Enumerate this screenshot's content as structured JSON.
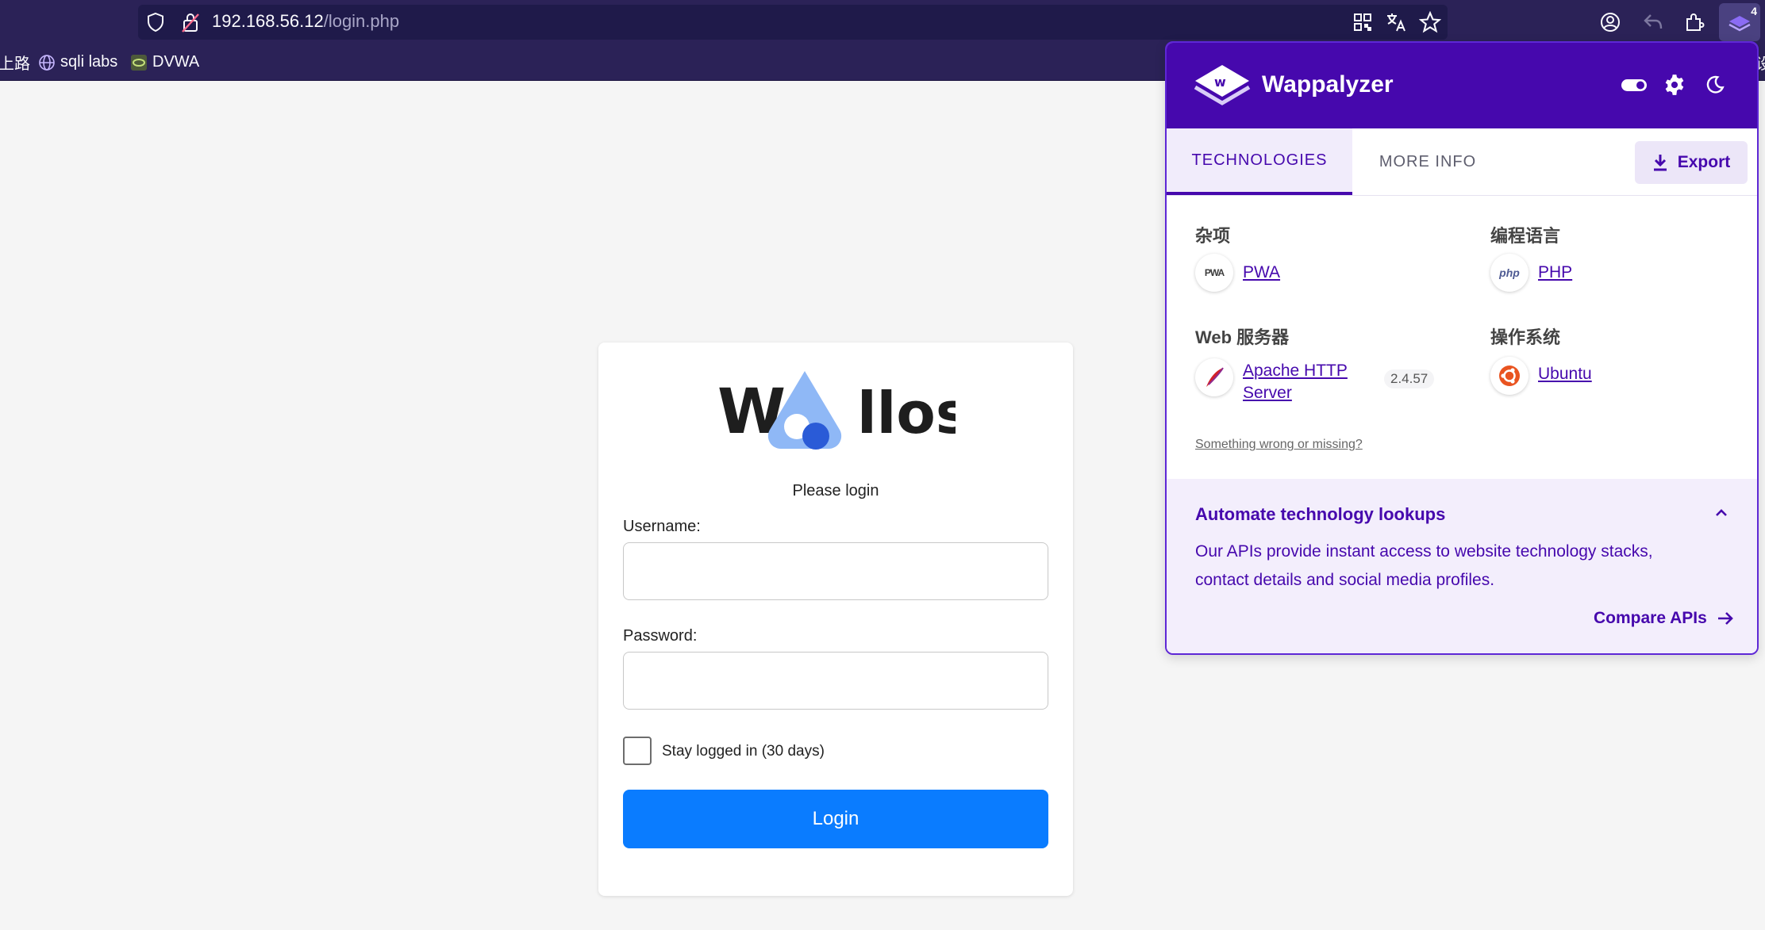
{
  "browser": {
    "url_host": "192.168.56.12",
    "url_path": "/login.php",
    "extension_badge": "4",
    "bookmarks": [
      {
        "label": "上路",
        "icon": "none"
      },
      {
        "label": "sqli labs",
        "icon": "globe-icon"
      },
      {
        "label": "DVWA",
        "icon": "dvwa-favicon"
      }
    ],
    "overflow_text": "设"
  },
  "login": {
    "logo_text_w": "W",
    "logo_text_rest": "llos",
    "heading": "Please login",
    "username_label": "Username:",
    "username_value": "",
    "password_label": "Password:",
    "password_value": "",
    "remember_label": "Stay logged in (30 days)",
    "remember_checked": false,
    "login_button": "Login",
    "accent_color": "#0a7cff"
  },
  "wappalyzer": {
    "brand": "Wappalyzer",
    "brand_color": "#4608ad",
    "tabs": [
      {
        "label": "TECHNOLOGIES",
        "active": true
      },
      {
        "label": "MORE INFO",
        "active": false
      }
    ],
    "export_label": "Export",
    "categories": [
      {
        "title": "杂项",
        "technologies": [
          {
            "name": "PWA",
            "icon": "pwa-icon",
            "version": ""
          }
        ]
      },
      {
        "title": "编程语言",
        "technologies": [
          {
            "name": "PHP",
            "icon": "php-icon",
            "version": ""
          }
        ]
      },
      {
        "title": "Web 服务器",
        "technologies": [
          {
            "name": "Apache HTTP Server",
            "name_line1": "Apache HTTP",
            "name_line2": "Server",
            "icon": "apache-feather-icon",
            "version": "2.4.57"
          }
        ]
      },
      {
        "title": "操作系统",
        "technologies": [
          {
            "name": "Ubuntu",
            "icon": "ubuntu-icon",
            "version": ""
          }
        ]
      }
    ],
    "feedback_link": "Something wrong or missing?",
    "promo": {
      "title": "Automate technology lookups",
      "text": "Our APIs provide instant access to website technology stacks, contact details and social media profiles.",
      "link": "Compare APIs"
    }
  }
}
